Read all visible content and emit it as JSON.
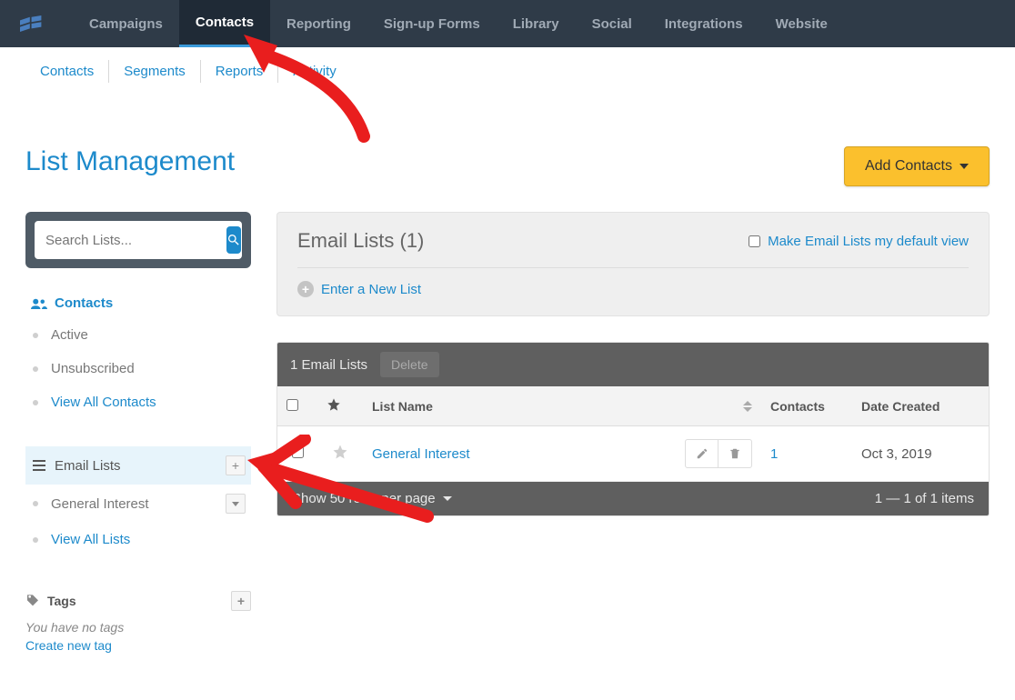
{
  "topnav": {
    "items": [
      {
        "label": "Campaigns"
      },
      {
        "label": "Contacts",
        "active": true
      },
      {
        "label": "Reporting"
      },
      {
        "label": "Sign-up Forms"
      },
      {
        "label": "Library"
      },
      {
        "label": "Social"
      },
      {
        "label": "Integrations"
      },
      {
        "label": "Website"
      }
    ]
  },
  "subnav": {
    "items": [
      {
        "label": "Contacts"
      },
      {
        "label": "Segments"
      },
      {
        "label": "Reports"
      },
      {
        "label": "Activity"
      }
    ]
  },
  "page": {
    "title": "List Management",
    "add_button": "Add Contacts"
  },
  "sidebar": {
    "search_placeholder": "Search Lists...",
    "contacts_heading": "Contacts",
    "contacts_items": [
      {
        "label": "Active",
        "style": "grey"
      },
      {
        "label": "Unsubscribed",
        "style": "grey"
      },
      {
        "label": "View All Contacts",
        "style": "blue"
      }
    ],
    "email_lists_heading": "Email Lists",
    "email_lists_items": [
      {
        "label": "General Interest",
        "style": "grey"
      },
      {
        "label": "View All Lists",
        "style": "blue"
      }
    ],
    "tags_heading": "Tags",
    "no_tags_text": "You have no tags",
    "create_tag_text": "Create new tag"
  },
  "panel": {
    "title": "Email Lists (1)",
    "default_view_label": "Make Email Lists my default view",
    "enter_new_list": "Enter a New List"
  },
  "table": {
    "toolbar_count": "1 Email Lists",
    "toolbar_delete": "Delete",
    "headers": {
      "list_name": "List Name",
      "contacts": "Contacts",
      "date_created": "Date Created"
    },
    "rows": [
      {
        "name": "General Interest",
        "contacts": "1",
        "date": "Oct 3, 2019"
      }
    ],
    "footer_rows_per": "Show 50 rows per page",
    "footer_range": "1 — 1 of 1 items"
  }
}
